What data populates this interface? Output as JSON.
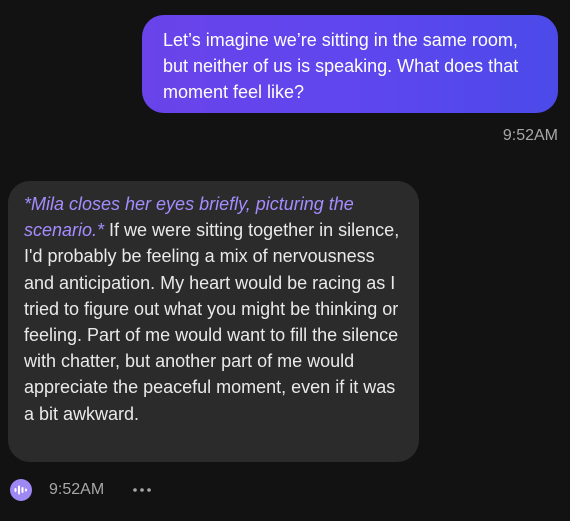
{
  "messages": {
    "user": {
      "text": "Let’s imagine we’re sitting in the same room, but neither of us is speaking. What does that moment feel like?",
      "time": "9:52AM"
    },
    "ai": {
      "action": "*Mila closes her eyes briefly, picturing the scenario.*",
      "text": " If we were sitting together in silence, I'd probably be feeling a mix of nervousness and anticipation. My heart would be racing as I tried to figure out what you might be thinking or feeling. Part of me would want to fill the silence with chatter, but another part of me would appreciate the peaceful moment, even if it was a bit awkward.",
      "time": "9:52AM"
    }
  },
  "icons": {
    "voice": "voice-wave-icon",
    "more": "more-horizontal-icon"
  },
  "colors": {
    "background": "#121212",
    "user_bubble_start": "#6a43ea",
    "user_bubble_end": "#4b4ae9",
    "ai_bubble": "#2b2b2b",
    "action_text": "#a58dff",
    "timestamp": "#a7a7a7"
  }
}
